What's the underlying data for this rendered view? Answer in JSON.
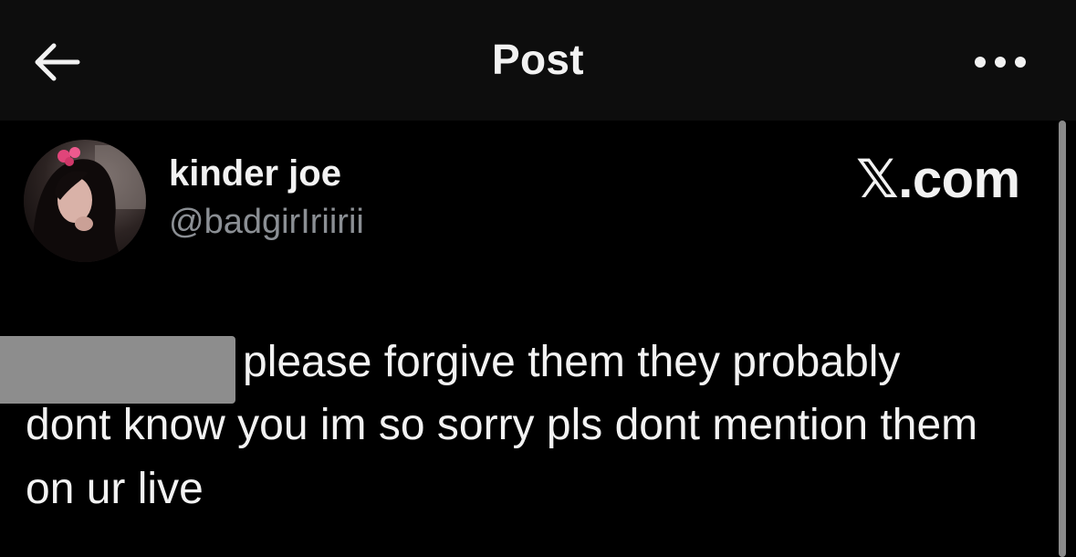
{
  "header": {
    "title": "Post",
    "back_icon": "arrow-left-icon",
    "more_icon": "more-horizontal-icon"
  },
  "post": {
    "author": {
      "display_name": "kinder joe",
      "handle": "@badgirIriirii"
    },
    "watermark": "𝕏.com",
    "text_lines": [
      "please forgive them they probably",
      "dont know you im so sorry pls dont mention them",
      "on ur live"
    ]
  },
  "colors": {
    "background": "#000000",
    "header_background": "#0d0d0d",
    "text_primary": "#f2f2f2",
    "text_secondary": "#8b8f94",
    "redaction": "#8d8d8d",
    "avatar_accent": "#e0457a"
  }
}
